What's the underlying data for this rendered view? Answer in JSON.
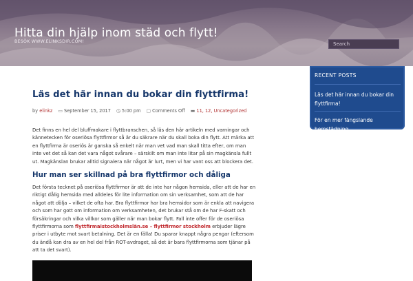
{
  "header": {
    "title": "Hitta din hjälp inom städ och flytt!",
    "description": "BESÖK WWW.ELINKSDIR.COM!",
    "search_placeholder": "Search"
  },
  "sidebar": {
    "widget_title": "RECENT POSTS",
    "posts": [
      "Läs det här innan du bokar din",
      "flyttfirma!",
      "För en mer fängslande hemstädning"
    ]
  },
  "post": {
    "title": "Läs det här innan du bokar din flyttfirma!",
    "meta": {
      "by": "by",
      "author": "elinkz",
      "date": "September 15, 2017",
      "time": "5:00 pm",
      "comments": "Comments Off",
      "categories": "11, 12, Uncategorized"
    },
    "para1": [
      "Det finns en hel del bluffmakare i flyttbranschen, så läs den här artikeln med varningar och",
      "kännetecken för oseriösa flyttfirmor så är du säkrare när du skall boka din flytt. Att märka att",
      "en flyttfirma är oseriös är ganska så enkelt när man vet vad man skall titta efter, om man",
      "inte vet det så kan det vara något svårare – särskilt om man inte litar på sin magkänsla fullt",
      "ut. Magkänslan brukar alltid signalera när något är lurt, men vi har vant oss att blockera det."
    ],
    "heading": "Hur man ser skillnad på bra flyttfirmor och dåliga",
    "para2": [
      "Det första tecknet på oseriösa flyttfirmor är att de inte har någon hemsida, eller att de har en",
      "riktigt dålig hemsida med alldeles för lite information om sin verksamhet, som att de har",
      "något att dölja – vilket de ofta har. Bra flyttfirmor har bra hemsidor som är enkla att navigera",
      "och som har gott om information om verksamheten, det brukar stå om de har F-skatt och",
      "försäkringar och vilka villkor som gäller när man bokar flytt. Fall inte offer för de oseriösa"
    ],
    "para2_line6_pre": "flyttfirmorna som ",
    "para2_link": "flyttfirmaistockholmslän.se – flyttfirmor stockholm",
    "para2_line6_post": " erbjuder lägre",
    "para2_rest": [
      "priser i utbyte mot svart betalning. Det är en fälla! Du sparar knappt några pengar (eftersom",
      "du ändå kan dra av en hel del från ROT-avdraget, så det är bara flyttfirmorna som tjänar på",
      "att ta det svart)."
    ]
  },
  "colors": {
    "header_bg": "#7d6f82",
    "widget_bg": "#1f4b8e",
    "title_color": "#15366a",
    "link_red": "#c0282d"
  }
}
